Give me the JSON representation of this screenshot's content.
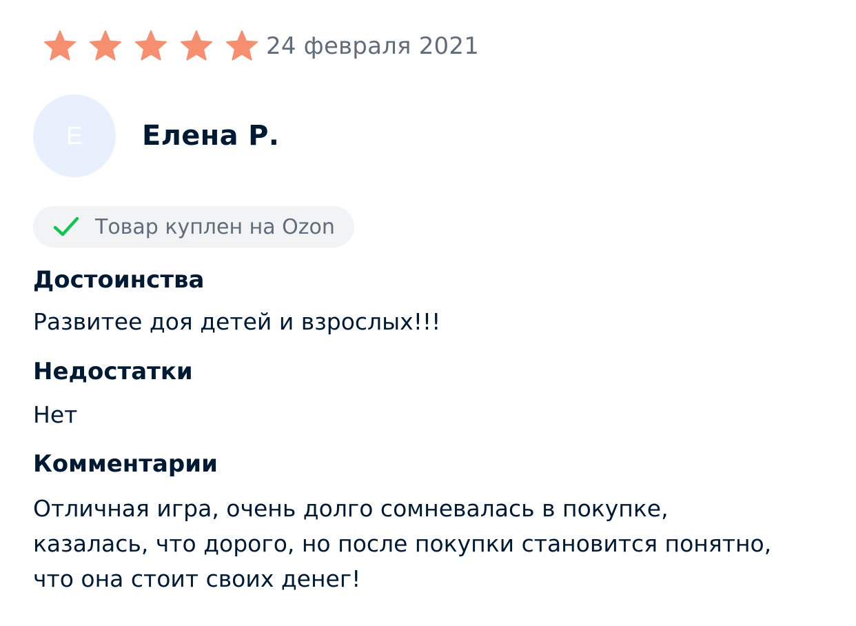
{
  "review": {
    "rating": 5,
    "rating_max": 5,
    "star_color": "#f68f6f",
    "date": "24 февраля 2021",
    "author": {
      "initial": "Е",
      "name": "Елена Р.",
      "avatar_color": "#e8effd"
    },
    "verified": {
      "label": "Товар куплен на Ozon",
      "icon": "checkmark-icon",
      "icon_color": "#10c44c"
    },
    "pros": {
      "heading": "Достоинства",
      "text": "Развитее доя детей и взрослых!!!"
    },
    "cons": {
      "heading": "Недостатки",
      "text": "Нет"
    },
    "comments": {
      "heading": "Комментарии",
      "lines": [
        "Отличная игра, очень долго сомневалась в покупке,",
        "казалась, что дорого, но после покупки становится понятно,",
        "что она стоит своих денег!"
      ]
    }
  }
}
